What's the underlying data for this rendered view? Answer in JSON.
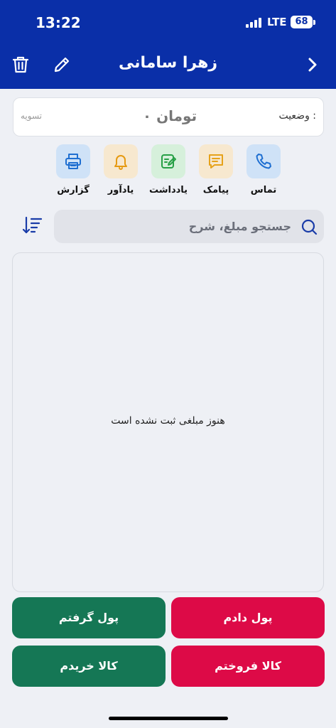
{
  "status_bar": {
    "time": "13:22",
    "network": "LTE",
    "battery": "68"
  },
  "header": {
    "title": "زهرا سامانی"
  },
  "status_card": {
    "label": "وضعیت :",
    "amount": "۰ تومان",
    "state": "تسویه"
  },
  "actions": [
    {
      "label": "تماس",
      "icon": "phone-icon"
    },
    {
      "label": "پیامک",
      "icon": "message-icon"
    },
    {
      "label": "یادداشت",
      "icon": "note-icon"
    },
    {
      "label": "یادآور",
      "icon": "bell-icon"
    },
    {
      "label": "گزارش",
      "icon": "printer-icon"
    }
  ],
  "search": {
    "placeholder": "جستجو مبلغ، شرح",
    "value": ""
  },
  "list": {
    "empty_message": "هنوز مبلغی ثبت نشده است"
  },
  "buttons": {
    "gave_money": "پول دادم",
    "got_money": "پول گرفتم",
    "sold_goods": "کالا فروختم",
    "bought_goods": "کالا خریدم"
  },
  "colors": {
    "header": "#0a2fa8",
    "red": "#dd0a47",
    "green": "#157755",
    "phone": "#cfe2f7",
    "message": "#f7e8cf",
    "note": "#d6f0db",
    "bell": "#f7e8cf",
    "printer": "#cfe2f7"
  }
}
